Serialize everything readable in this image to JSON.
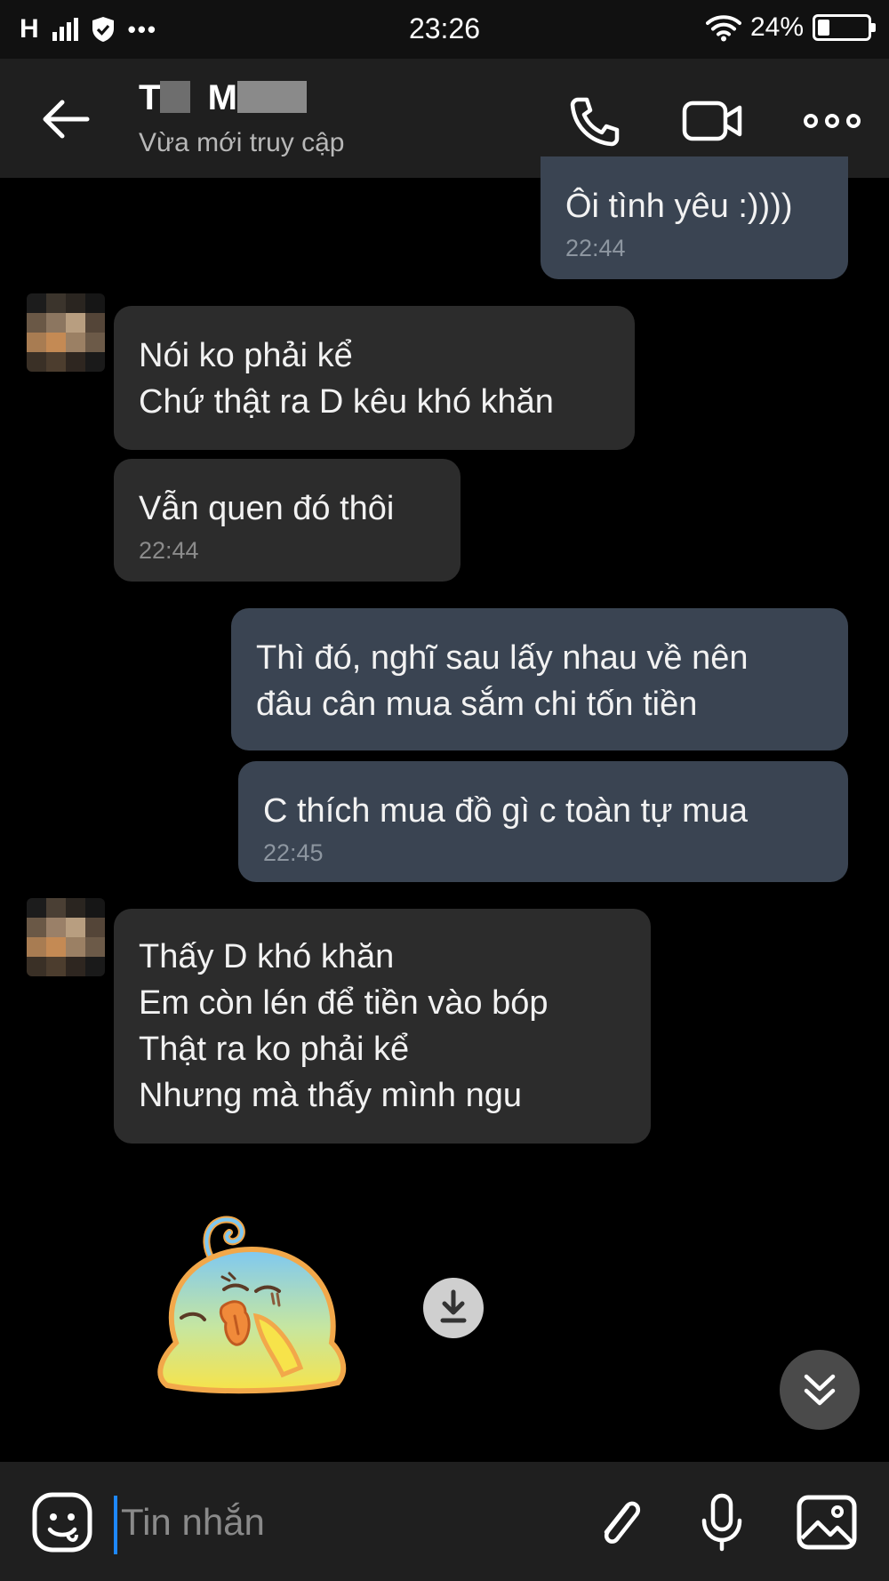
{
  "status_bar": {
    "network": "H",
    "time": "23:26",
    "battery_percent": "24%",
    "battery_level": 0.24,
    "icons": [
      "signal-icon",
      "shield-icon",
      "more-dots-icon",
      "wifi-icon",
      "battery-icon"
    ]
  },
  "header": {
    "contact_name_initial_1": "T",
    "contact_name_initial_2": "M",
    "contact_status": "Vừa mới truy cập",
    "icons": [
      "back-arrow-icon",
      "phone-icon",
      "video-call-icon",
      "more-options-icon"
    ]
  },
  "messages": [
    {
      "direction": "out",
      "lines": [
        "Ôi tình yêu :))))"
      ],
      "time": "22:44"
    },
    {
      "direction": "in",
      "lines": [
        "Nói ko phải kể",
        "Chứ thật ra D kêu khó khăn"
      ],
      "time": ""
    },
    {
      "direction": "in",
      "lines": [
        "Vẫn quen đó thôi"
      ],
      "time": "22:44"
    },
    {
      "direction": "out",
      "lines": [
        "Thì đó, nghĩ sau lấy nhau về nên",
        "đâu cân mua sắm chi tốn tiền"
      ],
      "time": ""
    },
    {
      "direction": "out",
      "lines": [
        "C thích mua đồ gì c toàn tự mua"
      ],
      "time": "22:45"
    },
    {
      "direction": "in",
      "lines": [
        "Thấy D khó khăn",
        "Em còn lén để tiền vào bóp",
        "Thật ra ko phải kể",
        "Nhưng mà thấy mình ngu"
      ],
      "time": ""
    }
  ],
  "composer": {
    "placeholder": "Tin nhắn",
    "value": "",
    "icons": [
      "emoji-icon",
      "attachment-icon",
      "microphone-icon",
      "image-icon"
    ]
  },
  "colors": {
    "incoming_bubble": "#2c2c2c",
    "outgoing_bubble": "#3a4452",
    "background": "#000000",
    "caret": "#1e88ff"
  }
}
